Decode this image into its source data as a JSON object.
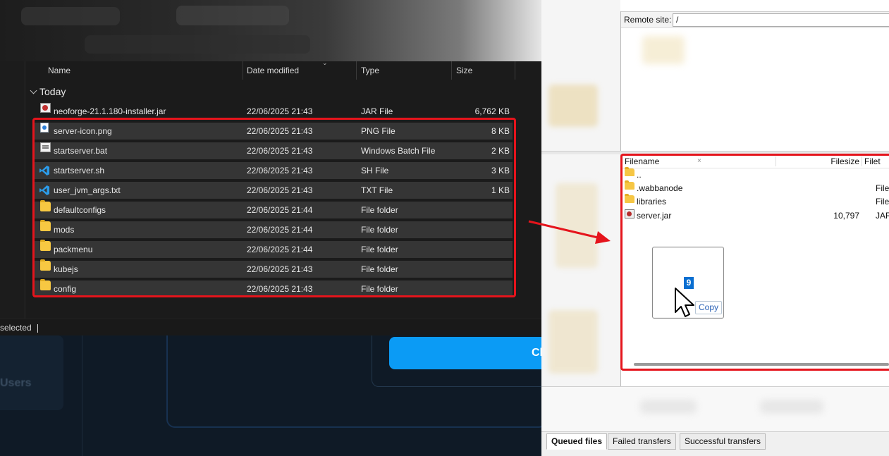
{
  "explorer": {
    "columns": {
      "name": "Name",
      "date": "Date modified",
      "type": "Type",
      "size": "Size"
    },
    "group_label": "Today",
    "files": [
      {
        "name": "neoforge-21.1.180-installer.jar",
        "date": "22/06/2025 21:43",
        "type": "JAR File",
        "size": "6,762 KB",
        "icon": "jar-icon",
        "selected": false
      },
      {
        "name": "server-icon.png",
        "date": "22/06/2025 21:43",
        "type": "PNG File",
        "size": "8 KB",
        "icon": "png-icon",
        "selected": true
      },
      {
        "name": "startserver.bat",
        "date": "22/06/2025 21:43",
        "type": "Windows Batch File",
        "size": "2 KB",
        "icon": "batch-icon",
        "selected": true
      },
      {
        "name": "startserver.sh",
        "date": "22/06/2025 21:43",
        "type": "SH File",
        "size": "3 KB",
        "icon": "vscode-icon",
        "selected": true
      },
      {
        "name": "user_jvm_args.txt",
        "date": "22/06/2025 21:43",
        "type": "TXT File",
        "size": "1 KB",
        "icon": "vscode-icon",
        "selected": true
      },
      {
        "name": "defaultconfigs",
        "date": "22/06/2025 21:44",
        "type": "File folder",
        "size": "",
        "icon": "folder-icon",
        "selected": true
      },
      {
        "name": "mods",
        "date": "22/06/2025 21:44",
        "type": "File folder",
        "size": "",
        "icon": "folder-icon",
        "selected": true
      },
      {
        "name": "packmenu",
        "date": "22/06/2025 21:44",
        "type": "File folder",
        "size": "",
        "icon": "folder-icon",
        "selected": true
      },
      {
        "name": "kubejs",
        "date": "22/06/2025 21:43",
        "type": "File folder",
        "size": "",
        "icon": "folder-icon",
        "selected": true
      },
      {
        "name": "config",
        "date": "22/06/2025 21:43",
        "type": "File folder",
        "size": "",
        "icon": "folder-icon",
        "selected": true
      }
    ],
    "status_text": "selected"
  },
  "dashboard": {
    "users_label": "Users",
    "button_label": "Cl"
  },
  "filezilla": {
    "remote_site_label": "Remote site:",
    "remote_site_value": "/",
    "columns": {
      "filename": "Filename",
      "filesize": "Filesize",
      "filetype": "Filet"
    },
    "files": [
      {
        "name": "..",
        "size": "",
        "type": "",
        "icon": "folder-icon"
      },
      {
        "name": ".wabbanode",
        "size": "",
        "type": "File",
        "icon": "folder-icon"
      },
      {
        "name": "libraries",
        "size": "",
        "type": "File",
        "icon": "folder-icon"
      },
      {
        "name": "server.jar",
        "size": "10,797",
        "type": "JAR",
        "icon": "jar-icon"
      }
    ],
    "drag_count": "9",
    "drag_action": "Copy",
    "tabs": [
      "Queued files",
      "Failed transfers",
      "Successful transfers"
    ],
    "active_tab": "Queued files"
  },
  "colors": {
    "highlight_red": "#e5141c",
    "explorer_bg": "#191919",
    "selected_row": "#353535",
    "dashboard_button": "#0b9bf5",
    "drag_badge": "#0a6fd1"
  }
}
